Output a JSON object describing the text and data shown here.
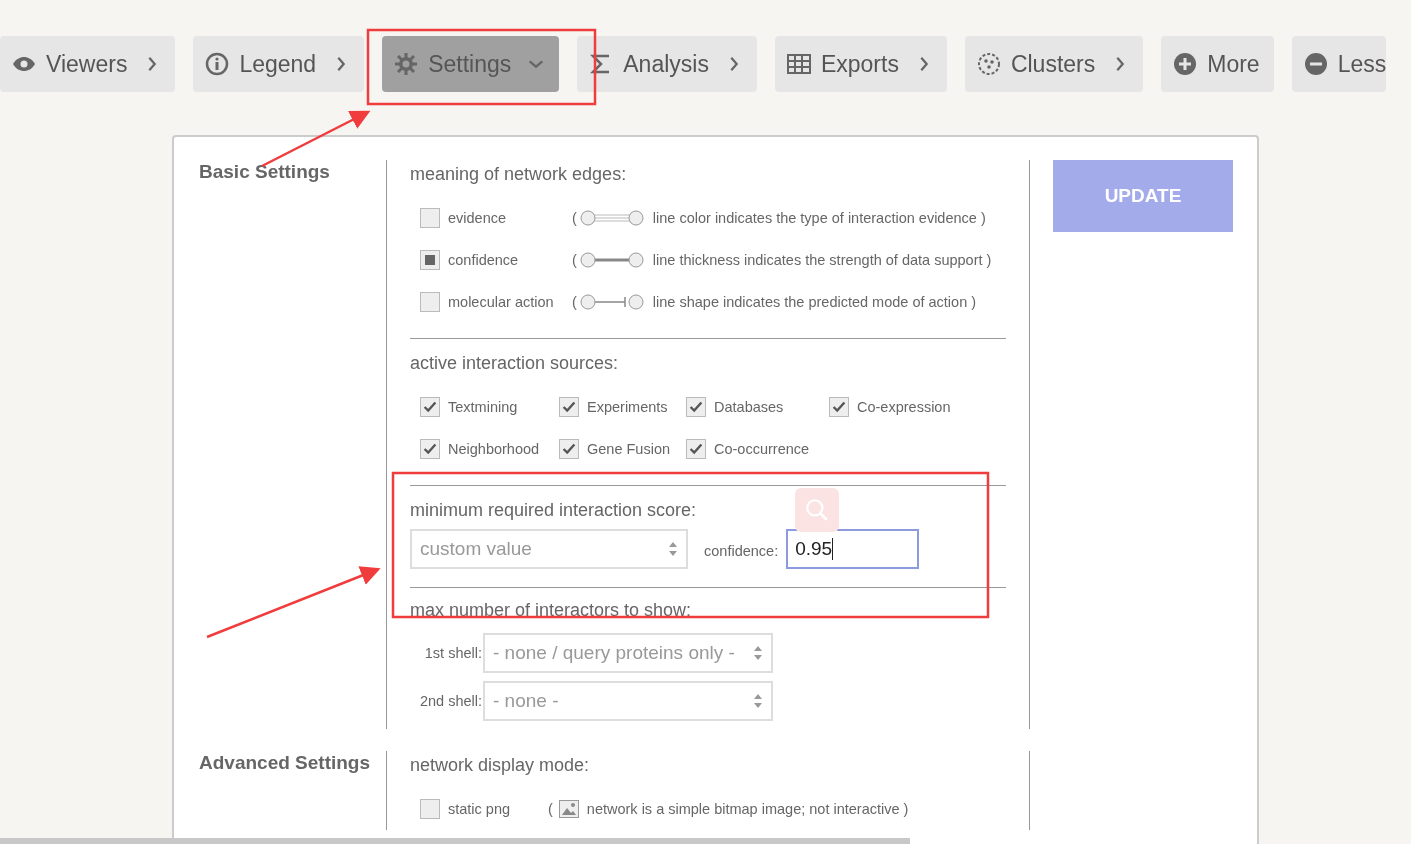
{
  "toolbar": [
    {
      "label": "Viewers",
      "kind": "menu",
      "selected": false,
      "expanded": false
    },
    {
      "label": "Legend",
      "kind": "menu",
      "selected": false,
      "expanded": false
    },
    {
      "label": "Settings",
      "kind": "menu",
      "selected": true,
      "expanded": true
    },
    {
      "label": "Analysis",
      "kind": "menu",
      "selected": false,
      "expanded": false
    },
    {
      "label": "Exports",
      "kind": "menu",
      "selected": false,
      "expanded": false
    },
    {
      "label": "Clusters",
      "kind": "menu",
      "selected": false,
      "expanded": false
    },
    {
      "label": "More",
      "kind": "action",
      "selected": false
    },
    {
      "label": "Less",
      "kind": "action",
      "selected": false
    }
  ],
  "basic": {
    "title": "Basic Settings",
    "edges": {
      "heading": "meaning of network edges:",
      "options": [
        {
          "label": "evidence",
          "checked": false,
          "paren": "(",
          "description": "line color indicates the type of interaction evidence )"
        },
        {
          "label": "confidence",
          "checked": true,
          "paren": "(",
          "description": "line thickness indicates the strength of data support )"
        },
        {
          "label": "molecular action",
          "checked": false,
          "paren": "(",
          "description": "line shape indicates the predicted mode of action )"
        }
      ]
    },
    "sources": {
      "heading": "active interaction sources:",
      "items": [
        {
          "label": "Textmining",
          "checked": true
        },
        {
          "label": "Experiments",
          "checked": true
        },
        {
          "label": "Databases",
          "checked": true
        },
        {
          "label": "Co-expression",
          "checked": true
        },
        {
          "label": "Neighborhood",
          "checked": true
        },
        {
          "label": "Gene Fusion",
          "checked": true
        },
        {
          "label": "Co-occurrence",
          "checked": true
        }
      ]
    },
    "score": {
      "heading": "minimum required interaction score:",
      "select": "custom value",
      "input_label": "confidence:",
      "input_value": "0.95"
    },
    "interactors": {
      "heading": "max number of interactors to show:",
      "shells": [
        {
          "label": "1st shell:",
          "value": "- none / query proteins only -"
        },
        {
          "label": "2nd shell:",
          "value": "- none -"
        }
      ]
    }
  },
  "update_button": "UPDATE",
  "advanced": {
    "title": "Advanced Settings",
    "heading": "network display mode:",
    "options": [
      {
        "label": "static png",
        "checked": false,
        "paren": "(",
        "description": "network is a simple bitmap image; not interactive )"
      }
    ]
  }
}
